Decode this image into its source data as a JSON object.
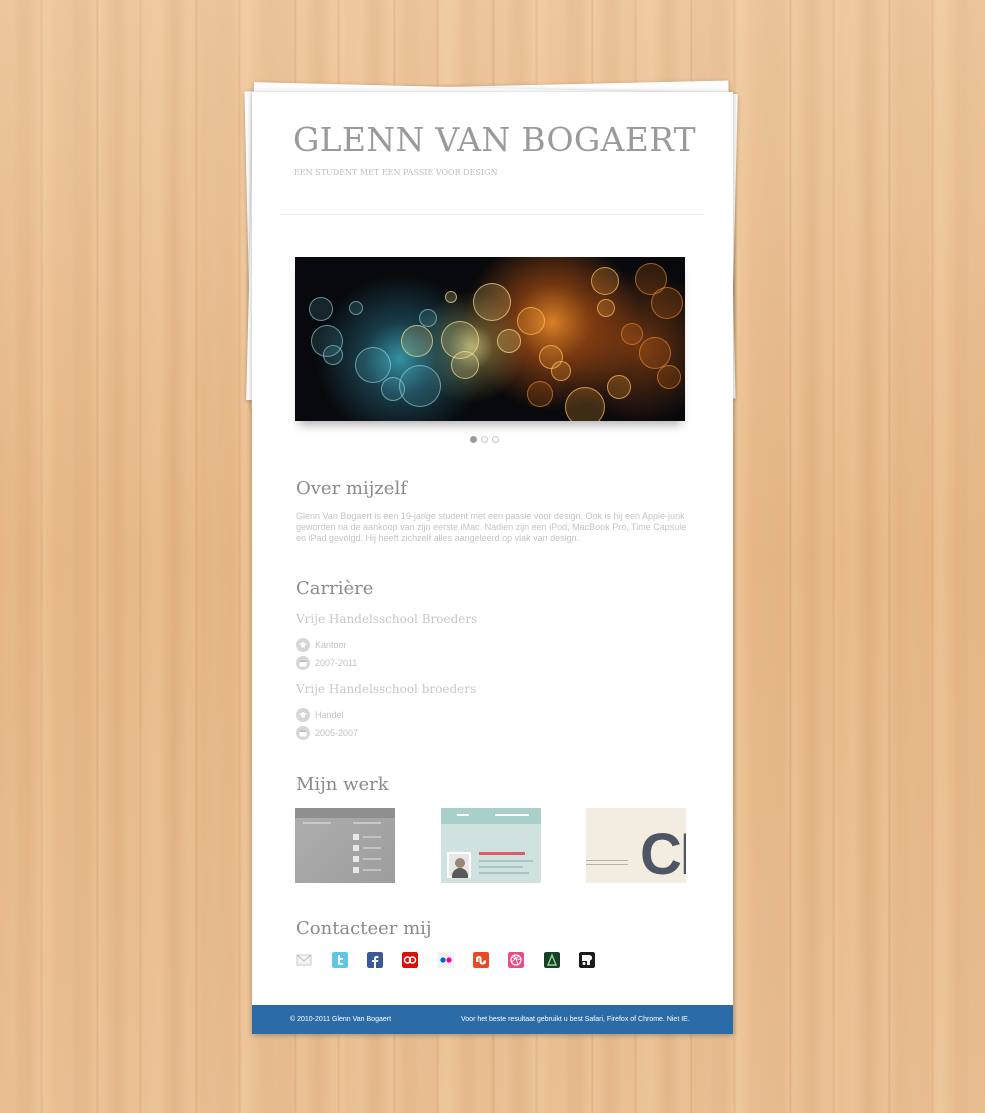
{
  "header": {
    "title": "GLENN VAN BOGAERT",
    "tagline": "EEN STUDENT MET EEN PASSIE VOOR DESIGN"
  },
  "slider": {
    "total_slides": 3,
    "active_index": 0
  },
  "about": {
    "heading": "Over mijzelf",
    "text": "Glenn Van Bogaert is een 19-jarige student met een passie voor design. Ook is hij een Apple-junk geworden na de aankoop van zijn eerste iMac. Nadien zijn een iPod, MacBook Pro, Time Capsule en iPad gevolgd. Hij heeft zichzelf alles aangeleerd op vlak van design."
  },
  "career": {
    "heading": "Carrière",
    "jobs": [
      {
        "school": "Vrije Handelsschool Broeders",
        "field": "Kantoor",
        "years": "2007-2011"
      },
      {
        "school": "Vrije Handelsschool broeders",
        "field": "Handel",
        "years": "2005-2007"
      }
    ]
  },
  "work": {
    "heading": "Mijn werk",
    "items": [
      {
        "name": "work-thumbnail-1"
      },
      {
        "name": "work-thumbnail-2",
        "nav_left": "HOME",
        "nav_right": "ONZE PRODUCTEN",
        "caption": "GLENN VAN BOGAERT"
      },
      {
        "name": "work-thumbnail-3",
        "big_text": "CE"
      }
    ]
  },
  "contact": {
    "heading": "Contacteer mij",
    "icons": [
      "mail-icon",
      "twitter-icon",
      "facebook-icon",
      "lastfm-icon",
      "flickr-icon",
      "stumbleupon-icon",
      "dribbble-icon",
      "deviantart-icon",
      "blip-icon"
    ]
  },
  "footer": {
    "copyright": "© 2010-2011 Glenn Van Bogaert",
    "note": "Voor het beste resultaat gebruikt u best Safari, Firefox of Chrome. Niet IE."
  },
  "colors": {
    "background_wood": "#e8b98a",
    "footer_bar": "#2b6ca8",
    "title_gray": "#9a9a9a",
    "body_text": "#c4c4c4"
  }
}
